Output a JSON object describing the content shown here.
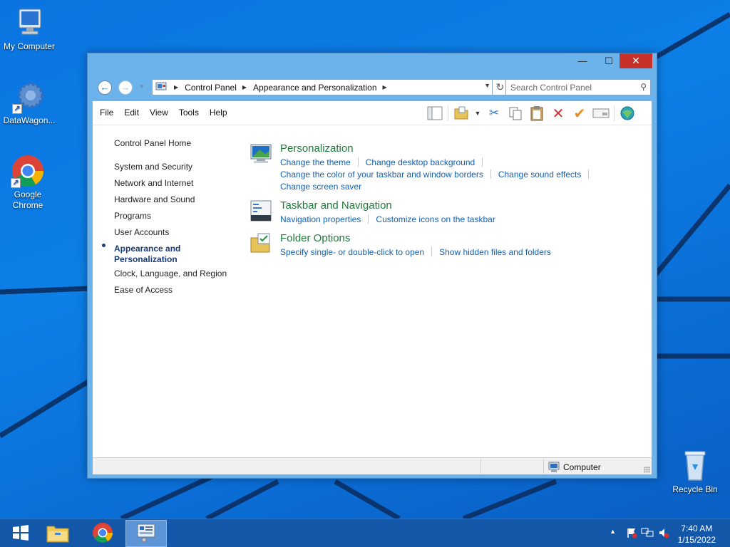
{
  "desktop": {
    "icons": [
      {
        "label": "My Computer",
        "icon": "computer-icon"
      },
      {
        "label": "DataWagon...",
        "icon": "gear-icon"
      },
      {
        "label": "Google Chrome",
        "icon": "chrome-icon"
      },
      {
        "label": "Recycle Bin",
        "icon": "recycle-bin-icon"
      }
    ]
  },
  "window": {
    "controls": {
      "minimize": "—",
      "maximize": "☐",
      "close": "✕"
    },
    "breadcrumb": [
      "Control Panel",
      "Appearance and Personalization"
    ],
    "search_placeholder": "Search Control Panel",
    "menu": [
      "File",
      "Edit",
      "View",
      "Tools",
      "Help"
    ],
    "toolbar_icons": [
      "layout-icon",
      "folder-icon",
      "dropdown-arrow-icon",
      "cut-icon",
      "copy-icon",
      "paste-icon",
      "delete-icon",
      "checkmark-icon",
      "properties-icon",
      "globe-icon"
    ]
  },
  "sidebar": {
    "home": "Control Panel Home",
    "items": [
      "System and Security",
      "Network and Internet",
      "Hardware and Sound",
      "Programs",
      "User Accounts",
      "Appearance and Personalization",
      "Clock, Language, and Region",
      "Ease of Access"
    ],
    "current": "Appearance and Personalization"
  },
  "categories": [
    {
      "title": "Personalization",
      "icon": "personalization-icon",
      "links": [
        "Change the theme",
        "Change desktop background",
        "Change the color of your taskbar and window borders",
        "Change sound effects",
        "Change screen saver"
      ]
    },
    {
      "title": "Taskbar and Navigation",
      "icon": "taskbar-icon",
      "links": [
        "Navigation properties",
        "Customize icons on the taskbar"
      ]
    },
    {
      "title": "Folder Options",
      "icon": "folder-options-icon",
      "links": [
        "Specify single- or double-click to open",
        "Show hidden files and folders"
      ]
    }
  ],
  "status": {
    "location": "Computer"
  },
  "taskbar": {
    "apps": [
      "start-icon",
      "file-explorer-icon",
      "chrome-icon",
      "control-panel-icon"
    ],
    "time": "7:40 AM",
    "date": "1/15/2022"
  },
  "colors": {
    "accent": "#1660b0",
    "category_title": "#1f7a3a",
    "close_button": "#c7312a",
    "taskbar": "#1357a8"
  }
}
